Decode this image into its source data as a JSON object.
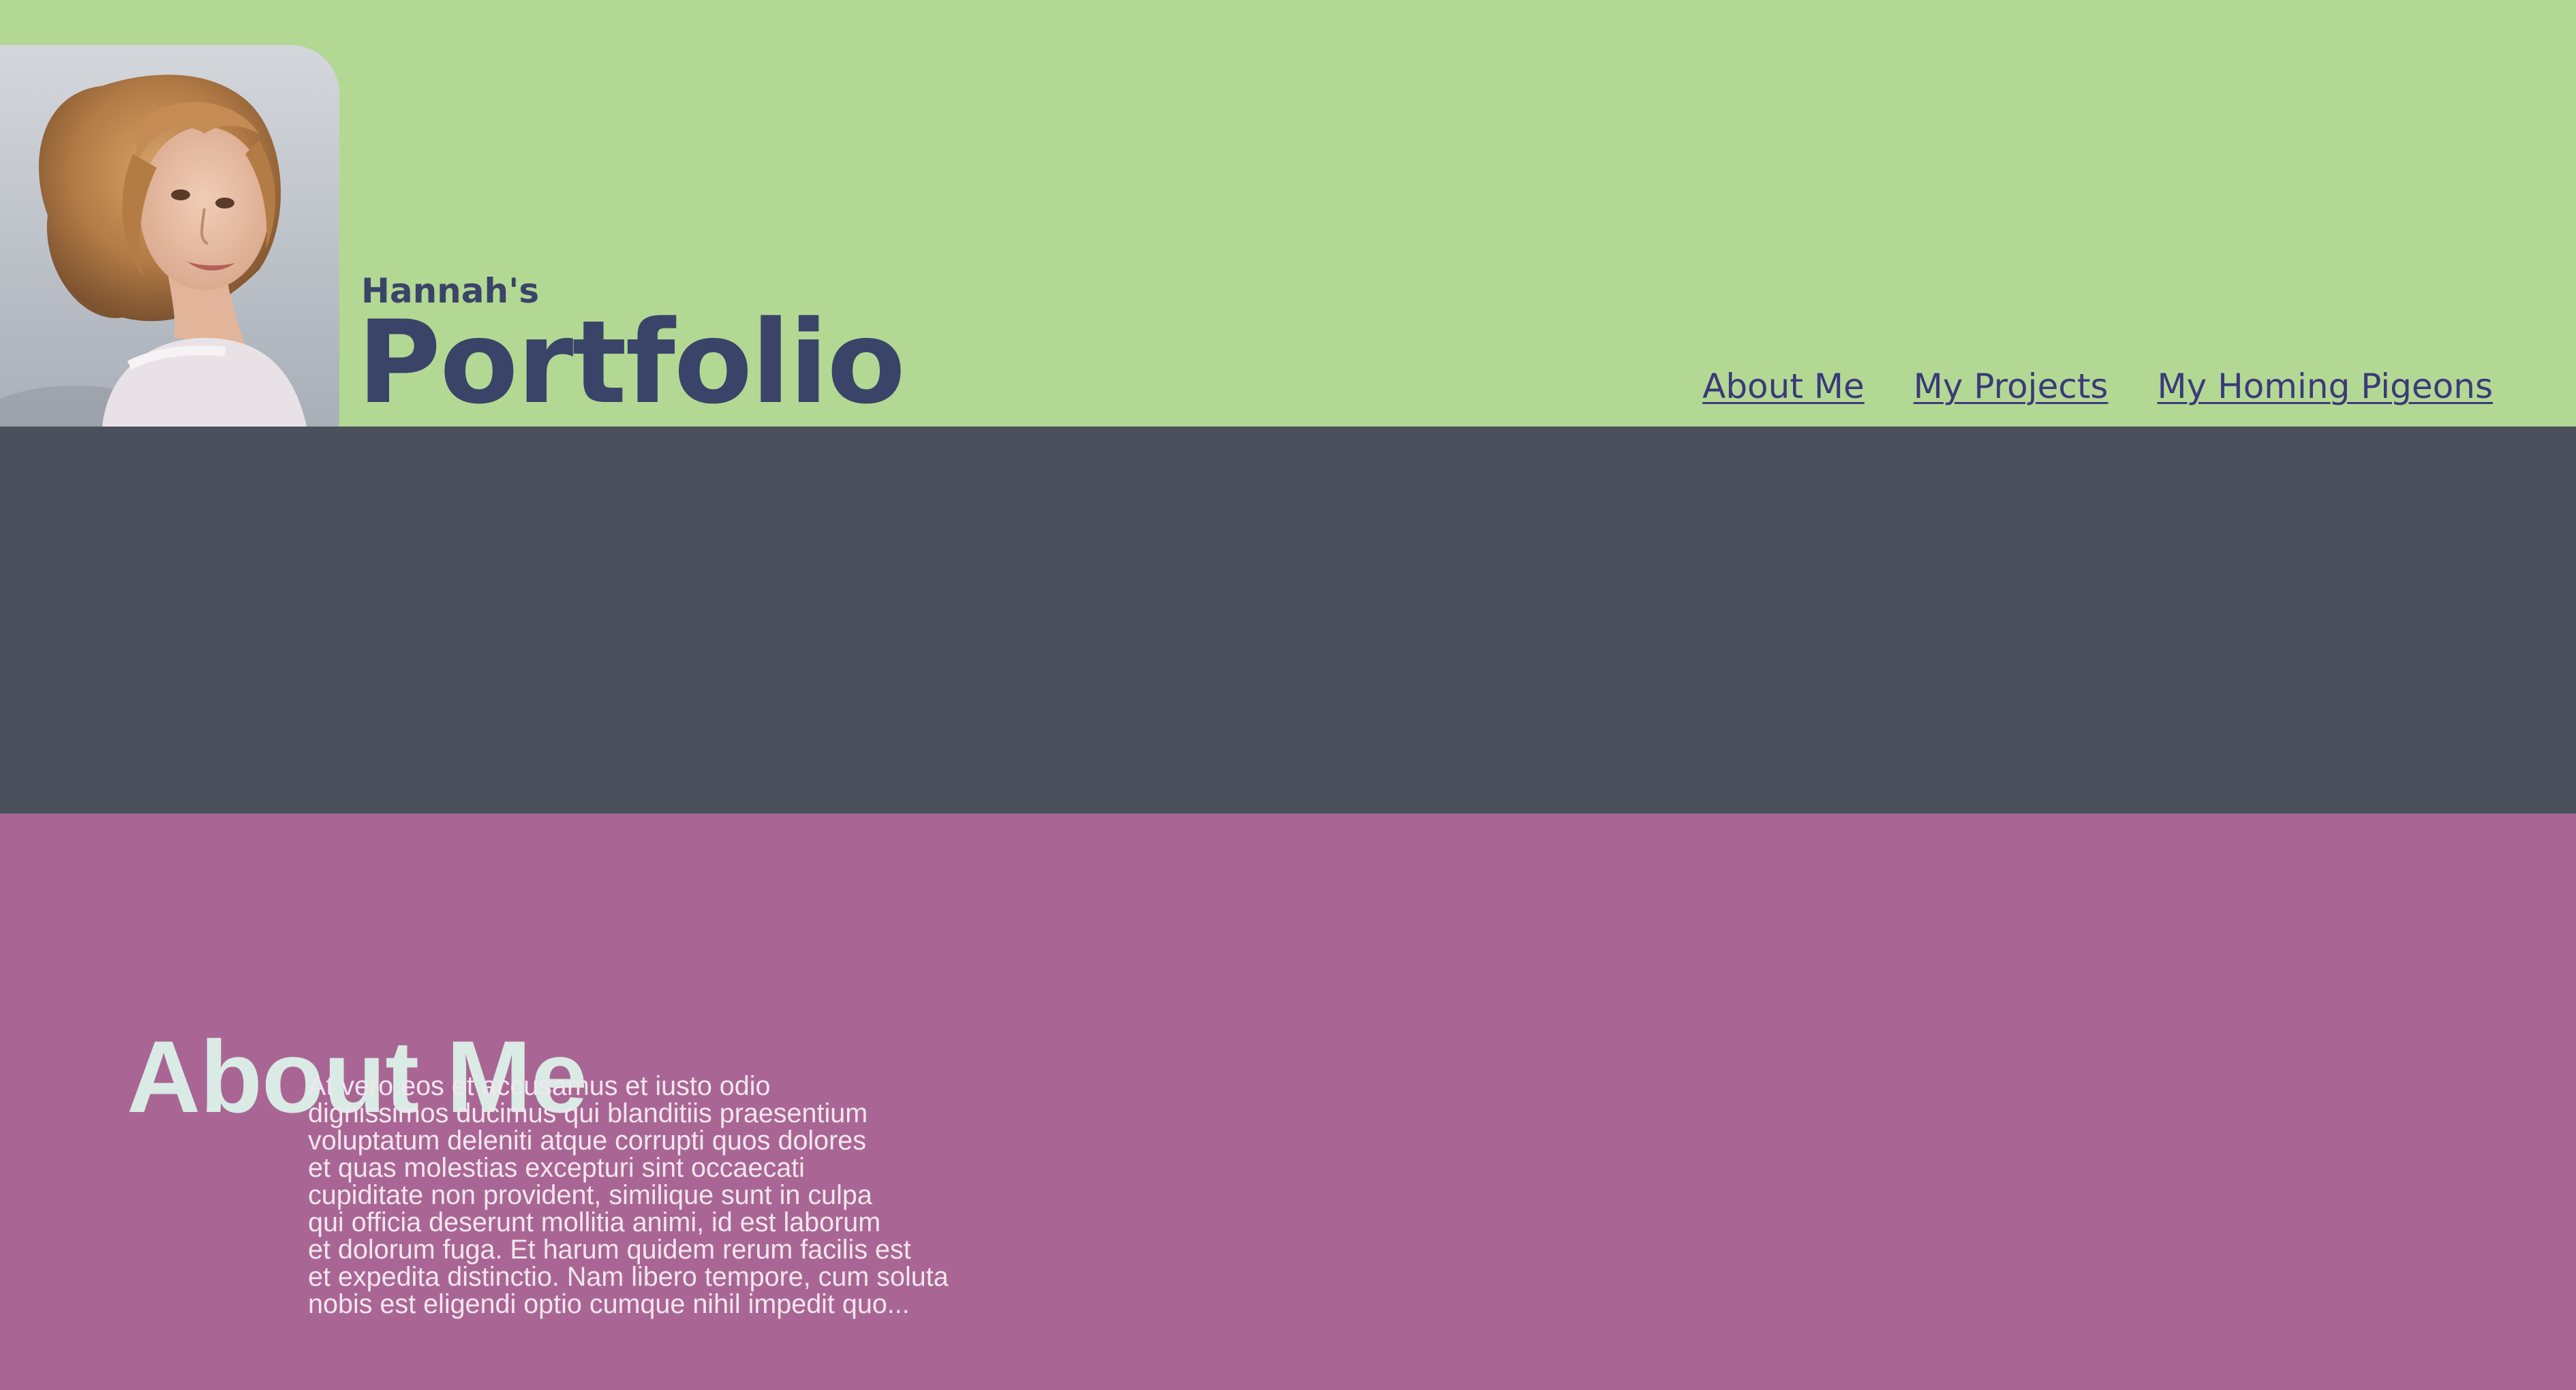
{
  "header": {
    "kicker": "Hannah's",
    "title": "Portfolio",
    "avatar_alt": "Portrait of Hannah",
    "nav": [
      {
        "label": "About Me"
      },
      {
        "label": "My Projects"
      },
      {
        "label": "My Homing Pigeons"
      }
    ]
  },
  "about": {
    "title": "About Me",
    "body": "At vero eos et accusamus et iusto odio\ndignissimos ducimus qui blanditiis praesentium\nvoluptatum deleniti atque corrupti quos dolores\net quas molestias excepturi sint occaecati\ncupiditate non provident, similique sunt in culpa\nqui officia deserunt mollitia animi, id est laborum\net dolorum fuga. Et harum quidem rerum facilis est\net expedita distinctio. Nam libero tempore, cum soluta\nnobis est eligendi optio cumque nihil impedit quo..."
  },
  "colors": {
    "header_bg": "#b3d894",
    "brand_text": "#3a4468",
    "nav_link": "#3b3a7a",
    "hero_bg": "#4b515c",
    "about_bg": "#a96694",
    "about_title": "#d9ebe4",
    "about_body": "#f3e6ee"
  }
}
